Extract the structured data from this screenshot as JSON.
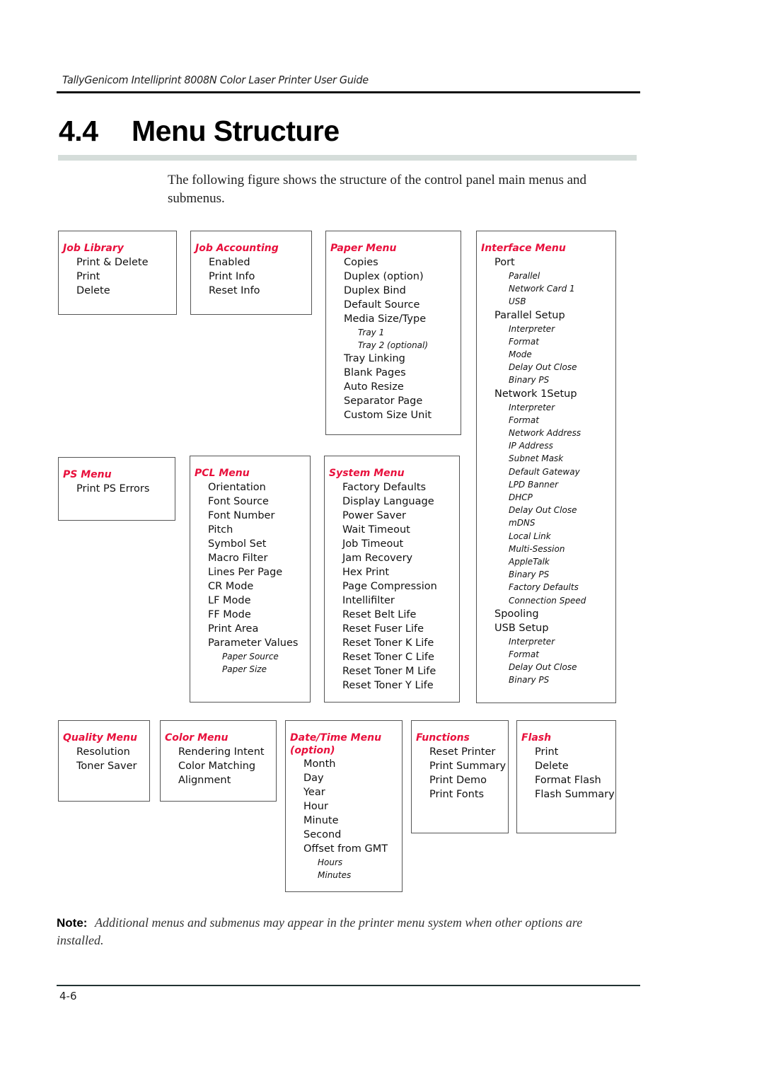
{
  "header": {
    "running_title": "TallyGenicom Intelliprint 8008N Color Laser Printer User Guide"
  },
  "section": {
    "number": "4.4",
    "title": "Menu Structure"
  },
  "intro": "The following figure shows the structure of the control panel main menus and submenus.",
  "accent_color": "#e8103c",
  "menus": {
    "job_library": {
      "title": "Job Library",
      "items": [
        "Print & Delete",
        "Print",
        "Delete"
      ]
    },
    "job_accounting": {
      "title": "Job Accounting",
      "items": [
        "Enabled",
        "Print Info",
        "Reset Info"
      ]
    },
    "paper_menu": {
      "title": "Paper Menu",
      "items": [
        "Copies",
        "Duplex (option)",
        "Duplex Bind",
        "Default Source",
        "Media Size/Type",
        "Tray 1",
        "Tray 2 (optional)",
        "Tray Linking",
        "Blank Pages",
        "Auto Resize",
        "Separator Page",
        "Custom Size Unit"
      ]
    },
    "interface_menu": {
      "title": "Interface Menu",
      "items": [
        "Port",
        "Parallel",
        "Network Card 1",
        "USB",
        "Parallel Setup",
        "Interpreter",
        "Format",
        "Mode",
        "Delay Out Close",
        "Binary PS",
        "Network 1Setup",
        "Interpreter",
        "Format",
        "Network Address",
        "IP Address",
        "Subnet Mask",
        "Default Gateway",
        "LPD Banner",
        "DHCP",
        "Delay Out Close",
        "mDNS",
        "Local Link",
        "Multi-Session",
        "AppleTalk",
        "Binary PS",
        "Factory Defaults",
        "Connection Speed",
        "Spooling",
        "USB Setup",
        "Interpreter",
        "Format",
        "Delay Out Close",
        "Binary PS"
      ]
    },
    "ps_menu": {
      "title": "PS Menu",
      "items": [
        "Print PS Errors"
      ]
    },
    "pcl_menu": {
      "title": "PCL Menu",
      "items": [
        "Orientation",
        "Font Source",
        "Font Number",
        "Pitch",
        "Symbol Set",
        "Macro Filter",
        "Lines Per Page",
        "CR Mode",
        "LF Mode",
        "FF Mode",
        "Print Area",
        "Parameter Values",
        "Paper Source",
        "Paper Size"
      ]
    },
    "system_menu": {
      "title": "System Menu",
      "items": [
        "Factory Defaults",
        "Display Language",
        "Power Saver",
        "Wait Timeout",
        "Job Timeout",
        "Jam Recovery",
        "Hex Print",
        "Page Compression",
        "Intellifilter",
        "Reset Belt Life",
        "Reset Fuser Life",
        "Reset Toner K Life",
        "Reset Toner C Life",
        "Reset Toner M Life",
        "Reset Toner Y Life"
      ]
    },
    "quality_menu": {
      "title": "Quality Menu",
      "items": [
        "Resolution",
        "Toner Saver"
      ]
    },
    "color_menu": {
      "title": "Color Menu",
      "items": [
        "Rendering Intent",
        "Color Matching",
        "Alignment"
      ]
    },
    "datetime_menu": {
      "title": "Date/Time Menu",
      "title_line2": "(option)",
      "items": [
        "Month",
        "Day",
        "Year",
        "Hour",
        "Minute",
        "Second",
        "Offset from GMT",
        "Hours",
        "Minutes"
      ]
    },
    "functions": {
      "title": "Functions",
      "items": [
        "Reset Printer",
        "Print Summary",
        "Print Demo",
        "Print Fonts"
      ]
    },
    "flash": {
      "title": "Flash",
      "items": [
        "Print",
        "Delete",
        "Format Flash",
        "Flash Summary"
      ]
    }
  },
  "note": {
    "label": "Note:",
    "text": "Additional menus and submenus may appear in the printer menu system when other options are installed."
  },
  "footer": {
    "page_number": "4-6"
  }
}
